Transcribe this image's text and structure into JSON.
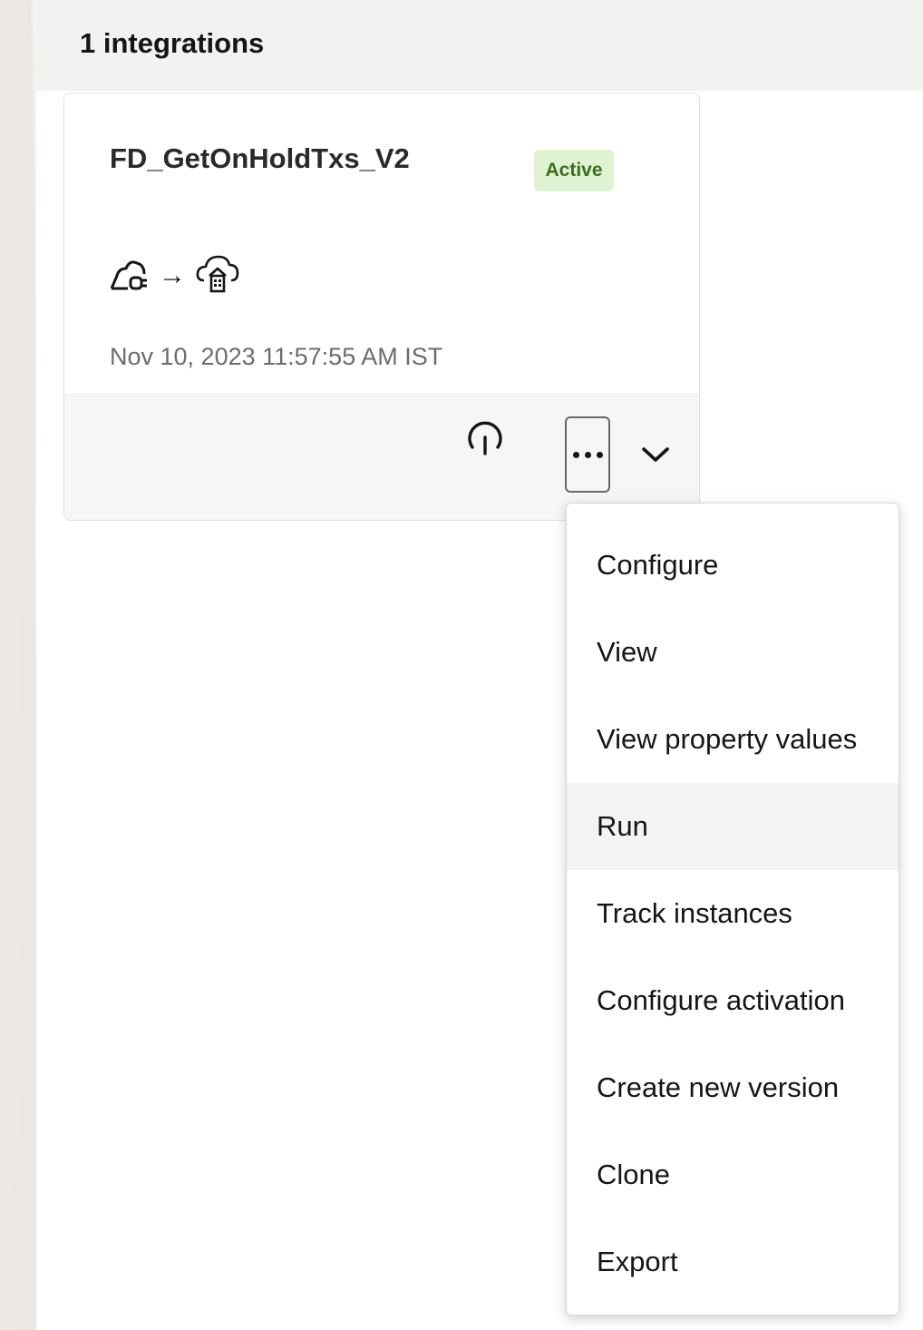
{
  "header": {
    "count_title": "1 integrations"
  },
  "card": {
    "name": "FD_GetOnHoldTxs_V2",
    "status": "Active",
    "status_color": "#3c6d1c",
    "status_bg": "#dff3d3",
    "source_icon": "cloud-adapter-icon",
    "arrow": "→",
    "target_icon": "cloud-building-icon",
    "timestamp": "Nov 10, 2023 11:57:55 AM IST",
    "actions": {
      "activate_icon": "power-icon",
      "more_icon": "ellipsis-icon",
      "expand_icon": "chevron-down-icon"
    }
  },
  "menu": {
    "highlighted": "Run",
    "items": [
      {
        "label": "Configure"
      },
      {
        "label": "View"
      },
      {
        "label": "View property values"
      },
      {
        "label": "Run"
      },
      {
        "label": "Track instances"
      },
      {
        "label": "Configure activation"
      },
      {
        "label": "Create new version"
      },
      {
        "label": "Clone"
      },
      {
        "label": "Export"
      }
    ]
  }
}
